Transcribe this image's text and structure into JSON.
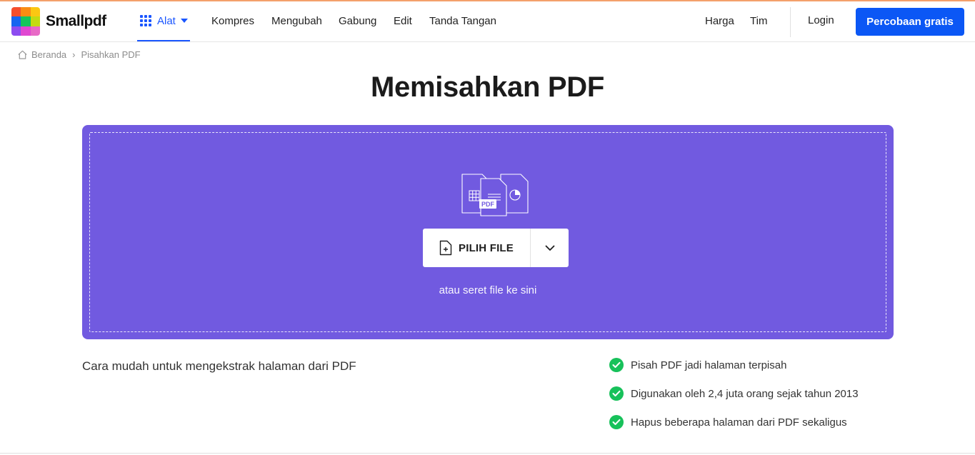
{
  "brand": {
    "name": "Smallpdf",
    "logo_colors": [
      "#f54e2c",
      "#f98c13",
      "#fbc712",
      "#1565f0",
      "#15c55b",
      "#c4db11",
      "#8c4cf0",
      "#e048d1",
      "#e86ac6"
    ]
  },
  "nav": {
    "tools_label": "Alat",
    "links": [
      "Kompres",
      "Mengubah",
      "Gabung",
      "Edit",
      "Tanda Tangan"
    ],
    "pricing": "Harga",
    "team": "Tim",
    "login": "Login",
    "cta": "Percobaan gratis"
  },
  "breadcrumb": {
    "home": "Beranda",
    "current": "Pisahkan PDF"
  },
  "page": {
    "title": "Memisahkan PDF"
  },
  "dropzone": {
    "pdf_badge": "PDF",
    "choose_label": "PILIH FILE",
    "hint": "atau seret file ke sini",
    "bg_color": "#715ae0"
  },
  "tagline": "Cara mudah untuk mengekstrak halaman dari PDF",
  "features": [
    "Pisah PDF jadi halaman terpisah",
    "Digunakan oleh 2,4 juta orang sejak tahun 2013",
    "Hapus beberapa halaman dari PDF sekaligus"
  ],
  "colors": {
    "accent": "#0b57f5",
    "check": "#17c15a"
  }
}
